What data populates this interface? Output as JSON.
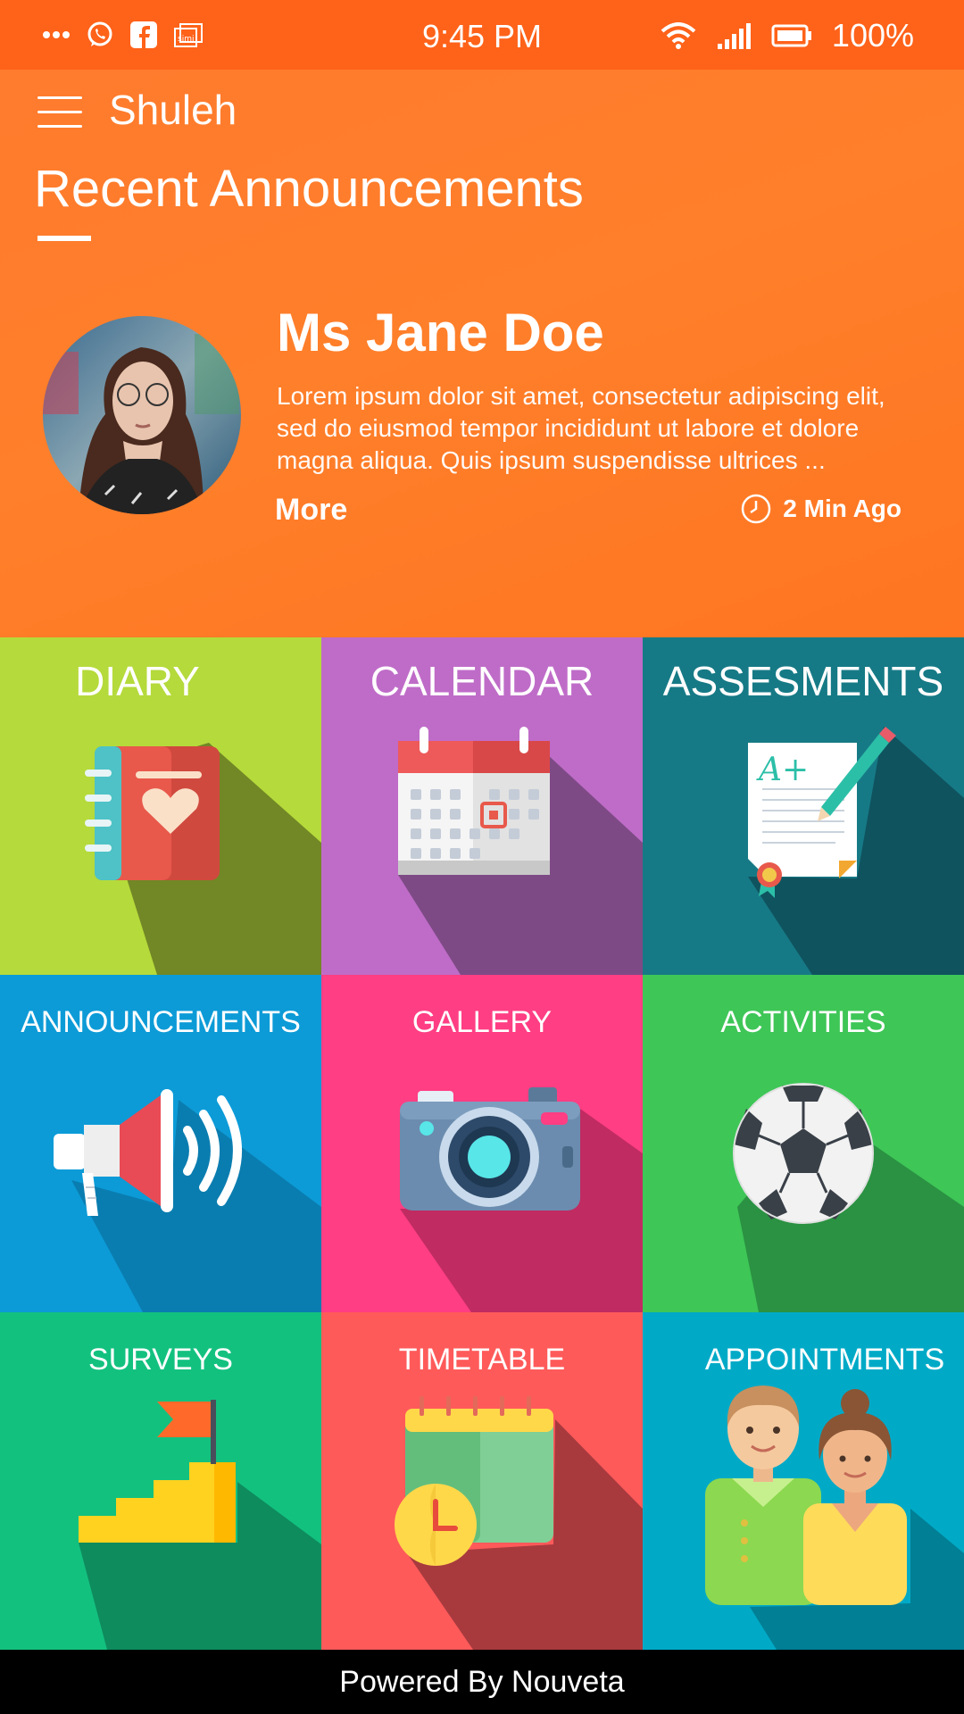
{
  "status_bar": {
    "time": "9:45 PM",
    "battery_percent": "100%",
    "left_icons": [
      "more-dots-icon",
      "whatsapp-icon",
      "facebook-icon",
      "simi-icon"
    ],
    "right_icons": [
      "wifi-icon",
      "signal-icon",
      "battery-icon"
    ]
  },
  "toolbar": {
    "app_title": "Shuleh"
  },
  "announcements": {
    "section_title": "Recent Announcements",
    "name": "Ms Jane Doe",
    "body": "Lorem ipsum dolor sit amet, consectetur adipiscing elit, sed do eiusmod tempor incididunt ut labore et dolore magna aliqua. Quis ipsum suspendisse ultrices ...",
    "more_label": "More",
    "time_ago": "2 Min Ago"
  },
  "tiles": [
    {
      "label": "DIARY",
      "color": "#B5DA3B",
      "icon": "diary-icon"
    },
    {
      "label": "CALENDAR",
      "color": "#BF6CC8",
      "icon": "calendar-icon"
    },
    {
      "label": "ASSESMENTS",
      "color": "#167A86",
      "icon": "assessment-icon"
    },
    {
      "label": "ANNOUNCEMENTS",
      "color": "#0C9BD7",
      "icon": "megaphone-icon"
    },
    {
      "label": "GALLERY",
      "color": "#FF3E83",
      "icon": "camera-icon"
    },
    {
      "label": "ACTIVITIES",
      "color": "#3EC657",
      "icon": "soccer-ball-icon"
    },
    {
      "label": "SURVEYS",
      "color": "#13C17F",
      "icon": "flag-stairs-icon"
    },
    {
      "label": "TIMETABLE",
      "color": "#FF5A5A",
      "icon": "timetable-icon"
    },
    {
      "label": "APPOINTMENTS",
      "color": "#00AAC7",
      "icon": "people-icon"
    }
  ],
  "assessment_grade": "A+",
  "footer": {
    "text": "Powered By Nouveta"
  }
}
